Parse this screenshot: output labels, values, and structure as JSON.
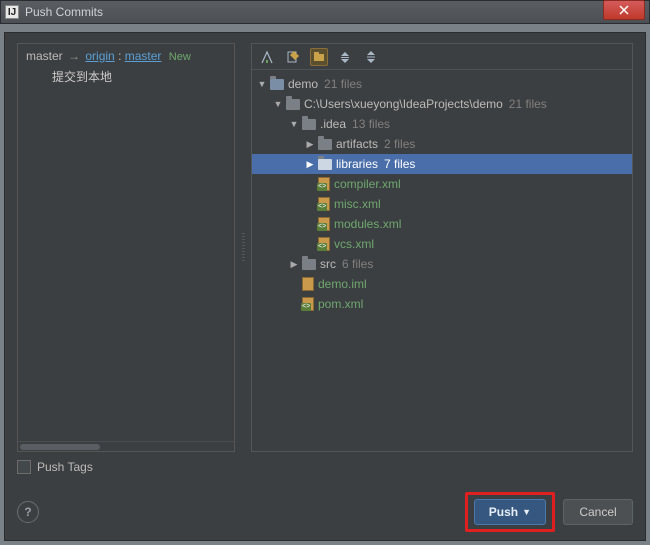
{
  "window": {
    "title": "Push Commits"
  },
  "branch": {
    "local": "master",
    "remote_name": "origin",
    "remote_branch": "master",
    "new_label": "New",
    "commit_message": "提交到本地"
  },
  "tree": {
    "root": {
      "name": "demo",
      "count": "21 files"
    },
    "path": {
      "name": "C:\\Users\\xueyong\\IdeaProjects\\demo",
      "count": "21 files"
    },
    "idea": {
      "name": ".idea",
      "count": "13 files"
    },
    "artifacts": {
      "name": "artifacts",
      "count": "2 files"
    },
    "libraries": {
      "name": "libraries",
      "count": "7 files"
    },
    "files_idea": [
      {
        "name": "compiler.xml"
      },
      {
        "name": "misc.xml"
      },
      {
        "name": "modules.xml"
      },
      {
        "name": "vcs.xml"
      }
    ],
    "src": {
      "name": "src",
      "count": "6 files"
    },
    "files_root": [
      {
        "name": "demo.iml"
      },
      {
        "name": "pom.xml"
      }
    ]
  },
  "options": {
    "push_tags_label": "Push Tags"
  },
  "buttons": {
    "push": "Push",
    "cancel": "Cancel"
  }
}
